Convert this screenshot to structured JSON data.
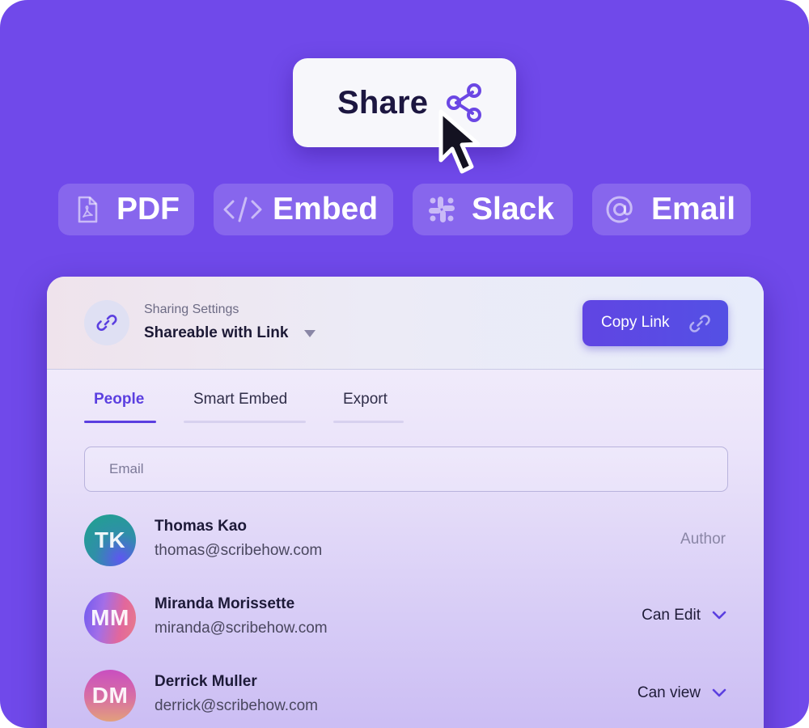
{
  "share": {
    "label": "Share"
  },
  "formats": [
    {
      "label": "PDF",
      "icon": "pdf-file-icon"
    },
    {
      "label": "Embed",
      "icon": "code-icon"
    },
    {
      "label": "Slack",
      "icon": "slack-icon"
    },
    {
      "label": "Email",
      "icon": "at-sign-icon"
    }
  ],
  "card": {
    "settings_caption": "Sharing Settings",
    "settings_value": "Shareable with Link",
    "copy_label": "Copy Link",
    "tabs": [
      {
        "label": "People",
        "active": true
      },
      {
        "label": "Smart Embed",
        "active": false
      },
      {
        "label": "Export",
        "active": false
      }
    ],
    "email_placeholder": "Email",
    "people": [
      {
        "initials": "TK",
        "name": "Thomas Kao",
        "email": "thomas@scribehow.com",
        "role": "Author"
      },
      {
        "initials": "MM",
        "name": "Miranda Morissette",
        "email": "miranda@scribehow.com",
        "role": "Can Edit"
      },
      {
        "initials": "DM",
        "name": "Derrick Muller",
        "email": "derrick@scribehow.com",
        "role": "Can view"
      }
    ]
  },
  "colors": {
    "background": "#7049ea",
    "accent": "#5b3fe0",
    "button": "#5b4be3"
  }
}
